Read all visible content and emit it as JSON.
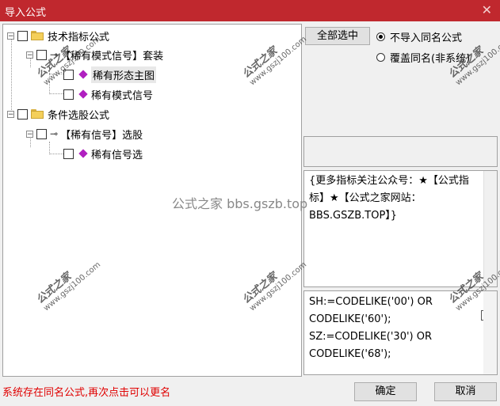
{
  "window": {
    "title": "导入公式",
    "close_glyph": "✕"
  },
  "tree": {
    "group1": {
      "label": "技术指标公式",
      "expander": "−"
    },
    "group1_child": {
      "label": "【稀有模式信号】套装",
      "expander": "−"
    },
    "group1_items": [
      "稀有形态主图",
      "稀有模式信号"
    ],
    "group2": {
      "label": "条件选股公式",
      "expander": "−"
    },
    "group2_child": {
      "label": "【稀有信号】选股",
      "expander": "−"
    },
    "group2_items": [
      "稀有信号选"
    ]
  },
  "right": {
    "select_all": "全部选中",
    "radio_skip": "不导入同名公式",
    "radio_overwrite": "覆盖同名(非系统)",
    "description": "{更多指标关注公众号：★【公式指标】★【公式之家网站：BBS.GSZB.TOP】}",
    "code": "SH:=CODELIKE('00') OR\nCODELIKE('60');\nSZ:=CODELIKE('30') OR\nCODELIKE('68');"
  },
  "status": "系统存在同名公式,再次点击可以更名",
  "buttons": {
    "ok": "确定",
    "cancel": "取消"
  },
  "watermarks": {
    "brand": "公式之家",
    "site": "www.gszj100.com",
    "center": "公式之家 bbs.gszb.top"
  },
  "colors": {
    "title_bar": "#c0282e",
    "status_text": "#e00000",
    "item_icon": "#b020c0"
  }
}
